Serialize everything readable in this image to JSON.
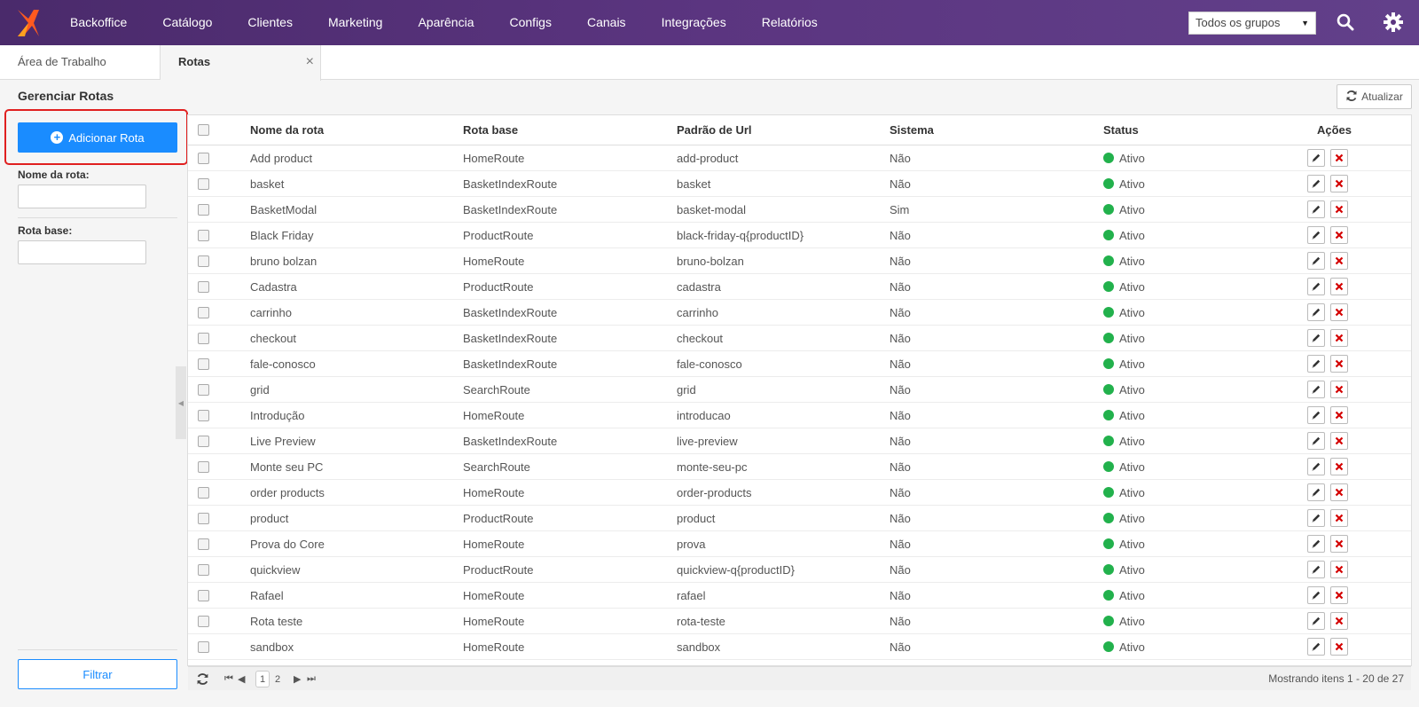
{
  "nav": {
    "items": [
      "Backoffice",
      "Catálogo",
      "Clientes",
      "Marketing",
      "Aparência",
      "Configs",
      "Canais",
      "Integrações",
      "Relatórios"
    ],
    "group_select": "Todos os grupos",
    "color": "#5b3580"
  },
  "tabs": [
    {
      "label": "Área de Trabalho"
    },
    {
      "label": "Rotas",
      "close": "×"
    }
  ],
  "page": {
    "title": "Gerenciar Rotas",
    "refresh_label": "Atualizar"
  },
  "sidebar": {
    "add_label": "Adicionar Rota",
    "name_label": "Nome da rota:",
    "base_label": "Rota base:",
    "filter_label": "Filtrar"
  },
  "table": {
    "headers": [
      "Nome da rota",
      "Rota base",
      "Padrão de Url",
      "Sistema",
      "Status",
      "Ações"
    ],
    "rows": [
      {
        "name": "Add product",
        "base": "HomeRoute",
        "url": "add-product",
        "system": "Não",
        "status": "Ativo"
      },
      {
        "name": "basket",
        "base": "BasketIndexRoute",
        "url": "basket",
        "system": "Não",
        "status": "Ativo"
      },
      {
        "name": "BasketModal",
        "base": "BasketIndexRoute",
        "url": "basket-modal",
        "system": "Sim",
        "status": "Ativo"
      },
      {
        "name": "Black Friday",
        "base": "ProductRoute",
        "url": "black-friday-q{productID}",
        "system": "Não",
        "status": "Ativo"
      },
      {
        "name": "bruno bolzan",
        "base": "HomeRoute",
        "url": "bruno-bolzan",
        "system": "Não",
        "status": "Ativo"
      },
      {
        "name": "Cadastra",
        "base": "ProductRoute",
        "url": "cadastra",
        "system": "Não",
        "status": "Ativo"
      },
      {
        "name": "carrinho",
        "base": "BasketIndexRoute",
        "url": "carrinho",
        "system": "Não",
        "status": "Ativo"
      },
      {
        "name": "checkout",
        "base": "BasketIndexRoute",
        "url": "checkout",
        "system": "Não",
        "status": "Ativo"
      },
      {
        "name": "fale-conosco",
        "base": "BasketIndexRoute",
        "url": "fale-conosco",
        "system": "Não",
        "status": "Ativo"
      },
      {
        "name": "grid",
        "base": "SearchRoute",
        "url": "grid",
        "system": "Não",
        "status": "Ativo"
      },
      {
        "name": "Introdução",
        "base": "HomeRoute",
        "url": "introducao",
        "system": "Não",
        "status": "Ativo"
      },
      {
        "name": "Live Preview",
        "base": "BasketIndexRoute",
        "url": "live-preview",
        "system": "Não",
        "status": "Ativo"
      },
      {
        "name": "Monte seu PC",
        "base": "SearchRoute",
        "url": "monte-seu-pc",
        "system": "Não",
        "status": "Ativo"
      },
      {
        "name": "order products",
        "base": "HomeRoute",
        "url": "order-products",
        "system": "Não",
        "status": "Ativo"
      },
      {
        "name": "product",
        "base": "ProductRoute",
        "url": "product",
        "system": "Não",
        "status": "Ativo"
      },
      {
        "name": "Prova do Core",
        "base": "HomeRoute",
        "url": "prova",
        "system": "Não",
        "status": "Ativo"
      },
      {
        "name": "quickview",
        "base": "ProductRoute",
        "url": "quickview-q{productID}",
        "system": "Não",
        "status": "Ativo"
      },
      {
        "name": "Rafael",
        "base": "HomeRoute",
        "url": "rafael",
        "system": "Não",
        "status": "Ativo"
      },
      {
        "name": "Rota teste",
        "base": "HomeRoute",
        "url": "rota-teste",
        "system": "Não",
        "status": "Ativo"
      },
      {
        "name": "sandbox",
        "base": "HomeRoute",
        "url": "sandbox",
        "system": "Não",
        "status": "Ativo"
      }
    ],
    "status_color": "#22b14c",
    "delete_color": "#d40000"
  },
  "pager": {
    "pages": [
      "1",
      "2"
    ],
    "info": "Mostrando itens 1 - 20 de 27"
  },
  "colors": {
    "primary": "#1a8cff",
    "highlight": "#e02020"
  }
}
